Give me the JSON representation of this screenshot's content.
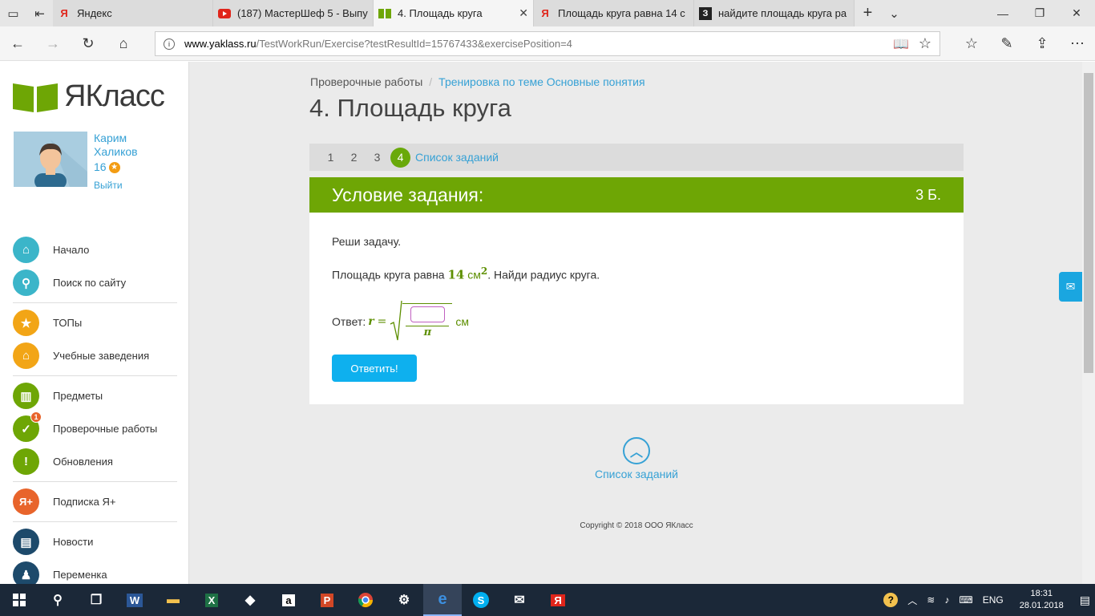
{
  "browser": {
    "tabs": [
      {
        "label": "Яндекс",
        "icon": "yandex-icon",
        "active": false
      },
      {
        "label": "(187) МастерШеф 5 - Выпу",
        "icon": "youtube-icon",
        "active": false
      },
      {
        "label": "4. Площадь круга",
        "icon": "yaklass-icon",
        "active": true
      },
      {
        "label": "Площадь круга равна 14 с",
        "icon": "yandex-icon",
        "active": false
      },
      {
        "label": "найдите площадь круга ра",
        "icon": "znanija-icon",
        "active": false
      }
    ],
    "url_domain": "www.yaklass.ru",
    "url_path": "/TestWorkRun/Exercise?testResultId=15767433&exercisePosition=4"
  },
  "sidebar": {
    "logo_text": "ЯКласс",
    "user_first": "Карим",
    "user_last": "Халиков",
    "points": "16",
    "logout": "Выйти",
    "menu": [
      {
        "label": "Начало",
        "icon": "home-icon",
        "color": "#3bb5c9"
      },
      {
        "label": "Поиск по сайту",
        "icon": "search-icon",
        "color": "#3bb5c9"
      },
      {
        "label": "ТОПы",
        "icon": "star-icon",
        "color": "#f2a516"
      },
      {
        "label": "Учебные заведения",
        "icon": "school-icon",
        "color": "#f2a516"
      },
      {
        "label": "Предметы",
        "icon": "book-icon",
        "color": "#6ea605"
      },
      {
        "label": "Проверочные работы",
        "icon": "check-icon",
        "color": "#6ea605",
        "badge": "1"
      },
      {
        "label": "Обновления",
        "icon": "exclamation-icon",
        "color": "#6ea605"
      },
      {
        "label": "Подписка Я+",
        "icon": "yaplus-icon",
        "color": "#e8642b"
      },
      {
        "label": "Новости",
        "icon": "chat-icon",
        "color": "#1d4a6b"
      },
      {
        "label": "Переменка",
        "icon": "bell-icon",
        "color": "#1d4a6b"
      }
    ]
  },
  "main": {
    "breadcrumb_root": "Проверочные работы",
    "breadcrumb_link": "Тренировка по теме Основные понятия",
    "title": "4. Площадь круга",
    "pager": [
      "1",
      "2",
      "3",
      "4"
    ],
    "current_page": "4",
    "tasks_link": "Список заданий",
    "task_header": "Условие задания:",
    "task_points": "3 Б.",
    "instruction": "Реши задачу.",
    "problem_before": "Площадь круга равна ",
    "problem_value": "14",
    "problem_unit": "см",
    "problem_power": "2",
    "problem_after": ".  Найди радиус круга.",
    "answer_label": "Ответ: ",
    "answer_var": "r",
    "answer_eq": "=",
    "answer_denominator": "π",
    "answer_unit": "см",
    "submit_button": "Ответить!",
    "back_to_list": "Список заданий",
    "copyright": "Copyright © 2018 ООО ЯКласс"
  },
  "taskbar": {
    "lang": "ENG",
    "time": "18:31",
    "date": "28.01.2018"
  }
}
